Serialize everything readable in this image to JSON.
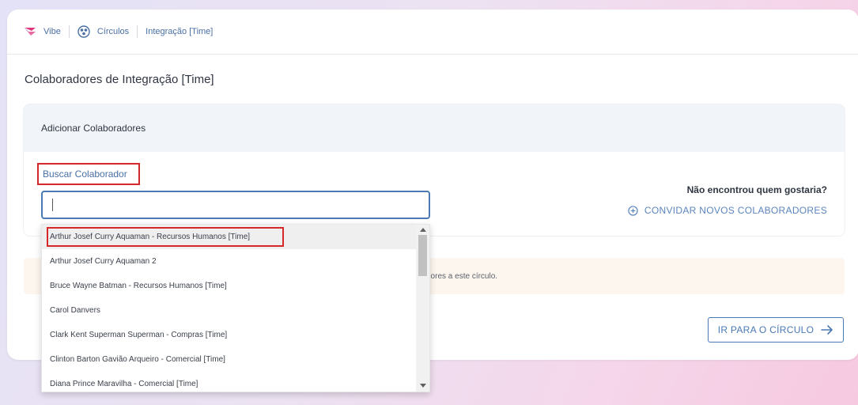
{
  "breadcrumb": {
    "items": [
      {
        "label": "Vibe",
        "icon": "vibe-logo-icon"
      },
      {
        "label": "Círculos",
        "icon": "circles-icon"
      },
      {
        "label": "Integração [Time]"
      }
    ]
  },
  "page": {
    "title": "Colaboradores de Integração [Time]"
  },
  "panel": {
    "header": "Adicionar Colaboradores",
    "search_label": "Buscar Colaborador",
    "search_value": "",
    "not_found_text": "Não encontrou quem gostaria?",
    "invite_label": "CONVIDAR NOVOS COLABORADORES"
  },
  "dropdown": {
    "options": [
      "Arthur Josef Curry Aquaman - Recursos Humanos [Time]",
      "Arthur Josef Curry Aquaman 2",
      "Bruce Wayne Batman - Recursos Humanos [Time]",
      "Carol Danvers",
      "Clark Kent Superman Superman - Compras [Time]",
      "Clinton Barton Gavião Arqueiro - Comercial [Time]",
      "Diana Prince Maravilha - Comercial [Time]"
    ],
    "highlighted_index": 0
  },
  "warning": {
    "text": "dores a este círculo."
  },
  "actions": {
    "go_to_circle": "IR PARA O CÍRCULO"
  },
  "colors": {
    "accent": "#4a79b4",
    "link": "#4a6fa5",
    "highlight_border": "#d62828",
    "brand_pink": "#e0357a",
    "panel_header_bg": "#f1f4f9",
    "warning_bg": "#fdf6ee"
  }
}
